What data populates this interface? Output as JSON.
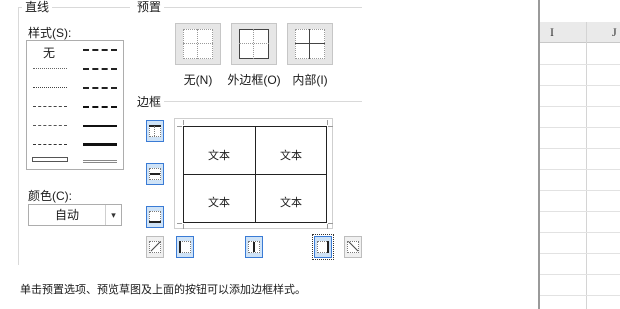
{
  "dialog": {
    "line_group_title": "直线",
    "style_label": "样式(S):",
    "style_none_label": "无",
    "color_label": "颜色(C):",
    "color_value": "自动",
    "presets_group_title": "预置",
    "presets": [
      {
        "label": "无(N)",
        "icon": "border-none-icon"
      },
      {
        "label": "外边框(O)",
        "icon": "border-outline-icon"
      },
      {
        "label": "内部(I)",
        "icon": "border-inside-icon"
      }
    ],
    "border_group_title": "边框",
    "preview_cells": [
      "文本",
      "文本",
      "文本",
      "文本"
    ],
    "hint": "单击预置选项、预览草图及上面的按钮可以添加边框样式。"
  },
  "sheet": {
    "columns": [
      "I",
      "J"
    ]
  },
  "colors": {
    "accent": "#3a7bd5",
    "button_face": "#e6e6e6",
    "toggle_bg": "#e3eef9"
  }
}
